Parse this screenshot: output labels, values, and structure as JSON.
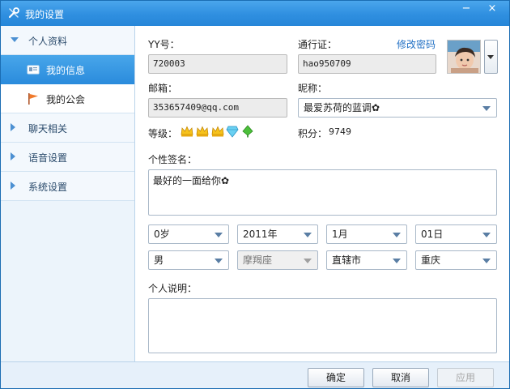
{
  "window": {
    "title": "我的设置",
    "minimize": "−",
    "close": "×"
  },
  "sidebar": {
    "groups": [
      {
        "label": "个人资料",
        "expanded": true
      },
      {
        "label": "聊天相关",
        "expanded": false
      },
      {
        "label": "语音设置",
        "expanded": false
      },
      {
        "label": "系统设置",
        "expanded": false
      }
    ],
    "items": [
      {
        "label": "我的信息",
        "active": true,
        "icon": "id-card-icon"
      },
      {
        "label": "我的公会",
        "active": false,
        "icon": "flag-icon"
      }
    ]
  },
  "profile": {
    "yy_label": "YY号：",
    "yy_value": "720003",
    "passport_label": "通行证：",
    "passport_value": "hao950709",
    "change_password": "修改密码",
    "email_label": "邮箱：",
    "email_value": "353657409@qq.com",
    "nickname_label": "昵称：",
    "nickname_value": "最爱苏荷的蓝调✿",
    "level_label": "等级：",
    "level_badges": [
      "crown-icon",
      "crown-icon",
      "crown-icon",
      "diamond-icon",
      "leaf-icon"
    ],
    "points_label": "积分：",
    "points_value": "9749",
    "signature_label": "个性签名：",
    "signature_value": "最好的一面给你✿",
    "age": "0岁",
    "year": "2011年",
    "month": "1月",
    "day": "01日",
    "gender": "男",
    "zodiac": "摩羯座",
    "province": "直辖市",
    "city": "重庆",
    "description_label": "个人说明：",
    "description_value": ""
  },
  "footer": {
    "ok": "确定",
    "cancel": "取消",
    "apply": "应用"
  },
  "colors": {
    "accent": "#2a8bdc",
    "titlebar": "#3a9be6",
    "link": "#1f6fc4"
  }
}
